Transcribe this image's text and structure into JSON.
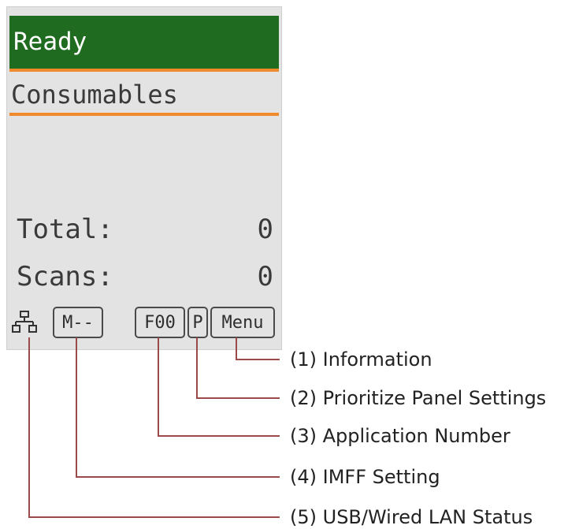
{
  "panel": {
    "status_text": "Ready",
    "screen_title": "Consumables",
    "counters": [
      {
        "label": "Total:",
        "value": "0"
      },
      {
        "label": "Scans:",
        "value": "0"
      }
    ],
    "icon_bar": {
      "lan_icon": "network-icon",
      "imff": "M--",
      "app_number": "F00",
      "priority": "P",
      "menu": "Menu"
    }
  },
  "callouts": [
    "(1) Information",
    "(2) Prioritize Panel Settings",
    "(3) Application Number",
    "(4) IMFF Setting",
    "(5) USB/Wired LAN Status"
  ],
  "colors": {
    "status_bar": "#1f6b20",
    "accent_line": "#f08a2c",
    "panel_bg": "#e3e3e3",
    "callout_line": "#9b4a4a"
  }
}
